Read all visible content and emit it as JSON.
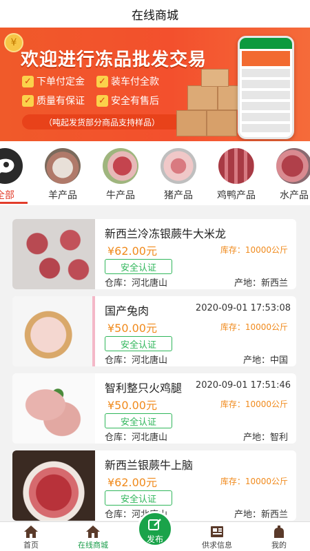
{
  "header": {
    "title": "在线商城"
  },
  "banner": {
    "headline": "欢迎进行冻品批发交易",
    "features": [
      "下单付定金",
      "装车付全款",
      "质量有保证",
      "安全有售后"
    ],
    "note": "（吨起发货部分商品支持样品）",
    "coin_glyph": "¥"
  },
  "categories": [
    {
      "label": "全部",
      "active": true
    },
    {
      "label": "羊产品"
    },
    {
      "label": "牛产品"
    },
    {
      "label": "猪产品"
    },
    {
      "label": "鸡鸭产品"
    },
    {
      "label": "水产品"
    }
  ],
  "products": [
    {
      "name": "新西兰冷冻银蕨牛大米龙",
      "date": "",
      "price": "¥62.00元",
      "stock": "库存：10000公斤",
      "badge": "安全认证",
      "warehouse": "仓库：河北唐山",
      "origin": "产地：新西兰"
    },
    {
      "name": "国产兔肉",
      "date": "2020-09-01 17:53:08",
      "price": "¥50.00元",
      "stock": "库存：10000公斤",
      "badge": "安全认证",
      "warehouse": "仓库：河北唐山",
      "origin": "产地：中国"
    },
    {
      "name": "智利整只火鸡腿",
      "date": "2020-09-01 17:51:46",
      "price": "¥50.00元",
      "stock": "库存：10000公斤",
      "badge": "安全认证",
      "warehouse": "仓库：河北唐山",
      "origin": "产地：智利"
    },
    {
      "name": "新西兰银蕨牛上脑",
      "date": "",
      "price": "¥62.00元",
      "stock": "库存：10000公斤",
      "badge": "安全认证",
      "warehouse": "仓库：河北唐山",
      "origin": "产地：新西兰"
    }
  ],
  "tabbar": {
    "items": [
      {
        "label": "首页",
        "icon": "home-icon"
      },
      {
        "label": "在线商城",
        "icon": "shop-icon",
        "active": true
      },
      {
        "label": "发布",
        "icon": "edit-icon"
      },
      {
        "label": "供求信息",
        "icon": "newspaper-icon"
      },
      {
        "label": "我的",
        "icon": "user-icon"
      }
    ]
  },
  "colors": {
    "accent_red": "#e23c2a",
    "accent_green": "#1aa34a",
    "price_orange": "#f08a1c"
  }
}
